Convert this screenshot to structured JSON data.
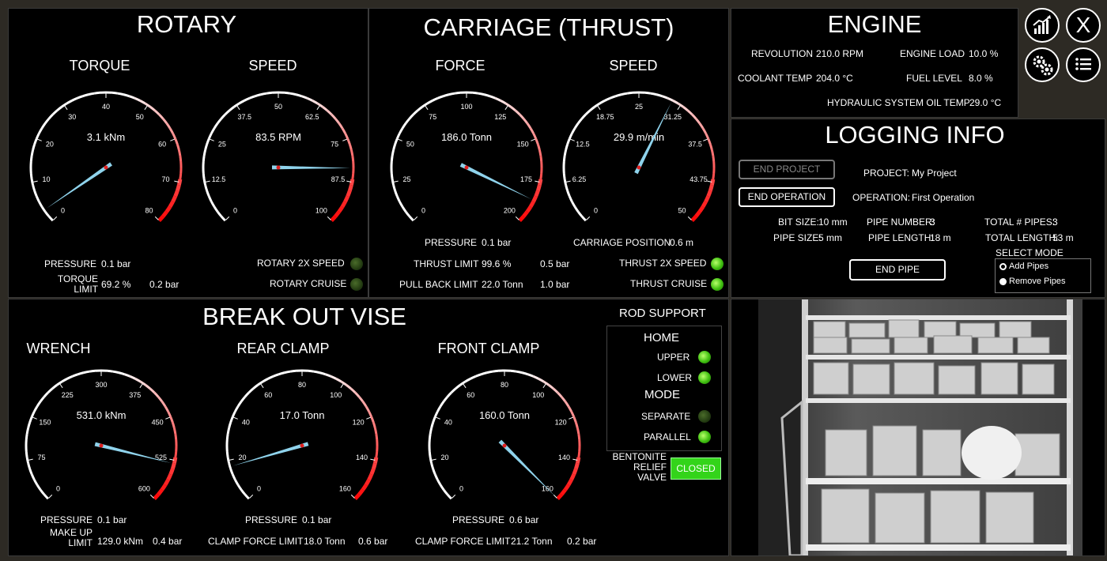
{
  "rotary": {
    "title": "ROTARY",
    "torque": {
      "title": "TORQUE",
      "value": "3.1 kNm",
      "ticks": [
        "0",
        "10",
        "20",
        "30",
        "40",
        "50",
        "60",
        "70",
        "80"
      ],
      "reading": 3.1,
      "min": 0,
      "max": 80
    },
    "speed": {
      "title": "SPEED",
      "value": "83.5 RPM",
      "ticks": [
        "0",
        "12.5",
        "25",
        "37.5",
        "50",
        "62.5",
        "75",
        "87.5",
        "100"
      ],
      "reading": 83.5,
      "min": 0,
      "max": 100
    },
    "pressure_label": "PRESSURE",
    "pressure_value": "0.1 bar",
    "torque_limit_label": "TORQUE LIMIT",
    "torque_limit_value": "69.2 %",
    "torque_limit_bar": "0.2 bar",
    "rotary_2x_label": "ROTARY 2X SPEED",
    "rotary_cruise_label": "ROTARY CRUISE"
  },
  "carriage": {
    "title": "CARRIAGE (THRUST)",
    "force": {
      "title": "FORCE",
      "value": "186.0 Tonn",
      "ticks": [
        "0",
        "25",
        "50",
        "75",
        "100",
        "125",
        "150",
        "175",
        "200"
      ],
      "reading": 186,
      "min": 0,
      "max": 200
    },
    "speed": {
      "title": "SPEED",
      "value": "29.9 m/min",
      "ticks": [
        "0",
        "6.25",
        "12.5",
        "18.75",
        "25",
        "31.25",
        "37.5",
        "43.75",
        "50"
      ],
      "reading": 29.9,
      "min": 0,
      "max": 50
    },
    "pressure_label": "PRESSURE",
    "pressure_value": "0.1 bar",
    "carriage_position_label": "CARRIAGE POSITION",
    "carriage_position_value": "0.6 m",
    "thrust_limit_label": "THRUST LIMIT",
    "thrust_limit_value": "99.6 %",
    "thrust_limit_bar": "0.5 bar",
    "pull_back_label": "PULL BACK LIMIT",
    "pull_back_value": "22.0 Tonn",
    "pull_back_bar": "1.0 bar",
    "thrust_2x_label": "THRUST 2X SPEED",
    "thrust_cruise_label": "THRUST CRUISE"
  },
  "engine": {
    "title": "ENGINE",
    "revolution_label": "REVOLUTION",
    "revolution_value": "210.0 RPM",
    "engine_load_label": "ENGINE LOAD",
    "engine_load_value": "10.0 %",
    "coolant_label": "COOLANT TEMP",
    "coolant_value": "204.0 °C",
    "fuel_label": "FUEL LEVEL",
    "fuel_value": "8.0 %",
    "hyd_label": "HYDRAULIC SYSTEM OIL TEMP",
    "hyd_value": "29.0 °C"
  },
  "toolbar": {
    "close_label": "X"
  },
  "logging": {
    "title": "LOGGING INFO",
    "end_project": "END PROJECT",
    "end_operation": "END OPERATION",
    "end_pipe": "END PIPE",
    "project_label": "PROJECT:",
    "project_value": "My Project",
    "operation_label": "OPERATION:",
    "operation_value": "First Operation",
    "bit_size_label": "BIT SIZE:",
    "bit_size_value": "10 mm",
    "pipe_size_label": "PIPE SIZE:",
    "pipe_size_value": "5 mm",
    "pipe_number_label": "PIPE NUMBER:",
    "pipe_number_value": "3",
    "pipe_length_label": "PIPE LENGTH:",
    "pipe_length_value": "18 m",
    "total_pipes_label": "TOTAL # PIPES:",
    "total_pipes_value": "3",
    "total_length_label": "TOTAL LENGTH:",
    "total_length_value": "53 m",
    "select_mode_label": "SELECT MODE",
    "add_pipes": "Add Pipes",
    "remove_pipes": "Remove Pipes"
  },
  "vise": {
    "title": "BREAK OUT VISE",
    "wrench": {
      "title": "WRENCH",
      "value": "531.0 kNm",
      "ticks": [
        "0",
        "75",
        "150",
        "225",
        "300",
        "375",
        "450",
        "525",
        "600"
      ],
      "reading": 531,
      "min": 0,
      "max": 600
    },
    "rear": {
      "title": "REAR CLAMP",
      "value": "17.0 Tonn",
      "ticks": [
        "0",
        "20",
        "40",
        "60",
        "80",
        "100",
        "120",
        "140",
        "160"
      ],
      "reading": 17,
      "min": 0,
      "max": 160
    },
    "front": {
      "title": "FRONT CLAMP",
      "value": "160.0 Tonn",
      "ticks": [
        "0",
        "20",
        "40",
        "60",
        "80",
        "100",
        "120",
        "140",
        "160"
      ],
      "reading": 160,
      "min": 0,
      "max": 160
    },
    "w_pressure_label": "PRESSURE",
    "w_pressure_value": "0.1 bar",
    "makeup_label": "MAKE UP LIMIT",
    "makeup_value": "129.0 kNm",
    "makeup_bar": "0.4 bar",
    "r_pressure_label": "PRESSURE",
    "r_pressure_value": "0.1 bar",
    "r_clamp_label": "CLAMP FORCE LIMIT",
    "r_clamp_value": "18.0 Tonn",
    "r_clamp_bar": "0.6 bar",
    "f_pressure_label": "PRESSURE",
    "f_pressure_value": "0.6 bar",
    "f_clamp_label": "CLAMP FORCE LIMIT",
    "f_clamp_value": "21.2 Tonn",
    "f_clamp_bar": "0.2 bar"
  },
  "rod_support": {
    "title": "ROD SUPPORT",
    "home": "HOME",
    "upper": "UPPER",
    "lower": "LOWER",
    "mode": "MODE",
    "separate": "SEPARATE",
    "parallel": "PARALLEL",
    "bentonite_label": "BENTONITE RELIEF VALVE",
    "closed_label": "CLOSED"
  },
  "colors": {
    "needle": "#8fd3ec",
    "redline": "#ff1a1a",
    "led_on": "#3fbf10"
  }
}
